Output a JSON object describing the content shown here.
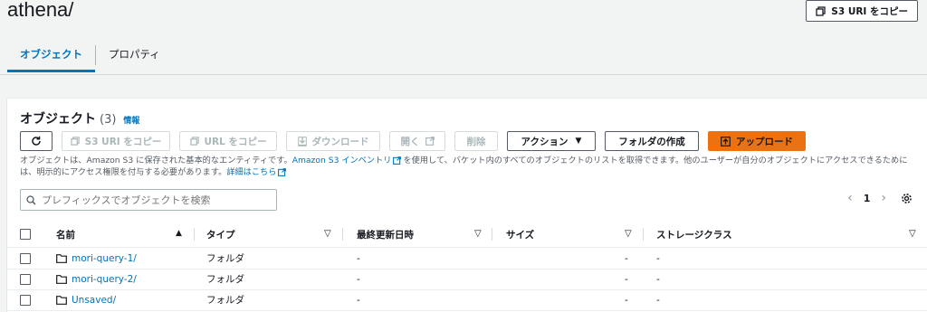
{
  "header": {
    "title": "athena/",
    "copy_s3_uri": "S3 URI をコピー"
  },
  "tabs": [
    {
      "label": "オブジェクト",
      "active": true
    },
    {
      "label": "プロパティ",
      "active": false
    }
  ],
  "panel": {
    "title": "オブジェクト",
    "count": "(3)",
    "info": "情報"
  },
  "toolbar": {
    "refresh": "",
    "copy_s3_uri": "S3 URI をコピー",
    "copy_url": "URL をコピー",
    "download": "ダウンロード",
    "open": "開く",
    "delete": "削除",
    "actions": "アクション",
    "create_folder": "フォルダの作成",
    "upload": "アップロード"
  },
  "description": {
    "part1": "オブジェクトは、Amazon S3 に保存された基本的なエンティティです。",
    "link1": "Amazon S3 インベントリ",
    "part2": "を使用して、バケット内のすべてのオブジェクトのリストを取得できます。他のユーザーが自分のオブジェクトにアクセスできるためには、明示的にアクセス権限を付与する必要があります。",
    "link2": "詳細はこちら"
  },
  "search": {
    "placeholder": "プレフィックスでオブジェクトを検索"
  },
  "pagination": {
    "page": "1"
  },
  "table": {
    "columns": [
      "名前",
      "タイプ",
      "最終更新日時",
      "サイズ",
      "ストレージクラス"
    ],
    "rows": [
      {
        "name": "mori-query-1/",
        "type": "フォルダ",
        "modified": "-",
        "size": "-",
        "storage": "-"
      },
      {
        "name": "mori-query-2/",
        "type": "フォルダ",
        "modified": "-",
        "size": "-",
        "storage": "-"
      },
      {
        "name": "Unsaved/",
        "type": "フォルダ",
        "modified": "-",
        "size": "-",
        "storage": "-"
      }
    ]
  },
  "colors": {
    "accent": "#0073bb",
    "primary_button": "#ec7211",
    "background": "#f2f3f3"
  }
}
